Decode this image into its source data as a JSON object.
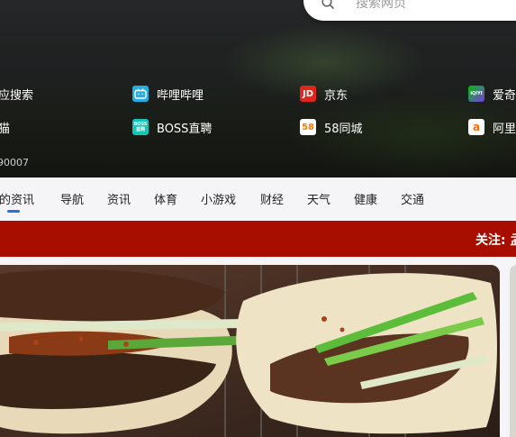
{
  "search": {
    "placeholder": "搜索网页"
  },
  "shortcuts": [
    {
      "label": "应搜索",
      "icon": "none",
      "color": ""
    },
    {
      "label": "哔哩哔哩",
      "icon": "bilibili-icon",
      "color": "#23ade5"
    },
    {
      "label": "京东",
      "icon": "jd-icon",
      "color": "#e1251b",
      "mark": "JD"
    },
    {
      "label": "爱奇",
      "icon": "iqiyi-icon",
      "color": "#00be06",
      "mark": "iQIYI"
    },
    {
      "label": "猫",
      "icon": "none",
      "color": ""
    },
    {
      "label": "BOSS直聘",
      "icon": "boss-zhipin-icon",
      "color": "#13c7b8",
      "mark": "BOSS 直聘"
    },
    {
      "label": "58同城",
      "icon": "58-tongcheng-icon",
      "color": "#ff7a00",
      "mark": "58"
    },
    {
      "label": "阿里",
      "icon": "aliyun-icon",
      "color": "#ff6a00",
      "mark": "a"
    }
  ],
  "hero_count": "90007",
  "tabs": [
    {
      "label": "的资讯",
      "active": true
    },
    {
      "label": "导航"
    },
    {
      "label": "资讯"
    },
    {
      "label": "体育"
    },
    {
      "label": "小游戏"
    },
    {
      "label": "财经"
    },
    {
      "label": "天气"
    },
    {
      "label": "健康"
    },
    {
      "label": "交通"
    }
  ],
  "banner": {
    "text": "关注: 孟",
    "background": "#a80e00"
  },
  "colors": {
    "accent": "#1a73e8",
    "banner": "#a80e00"
  }
}
